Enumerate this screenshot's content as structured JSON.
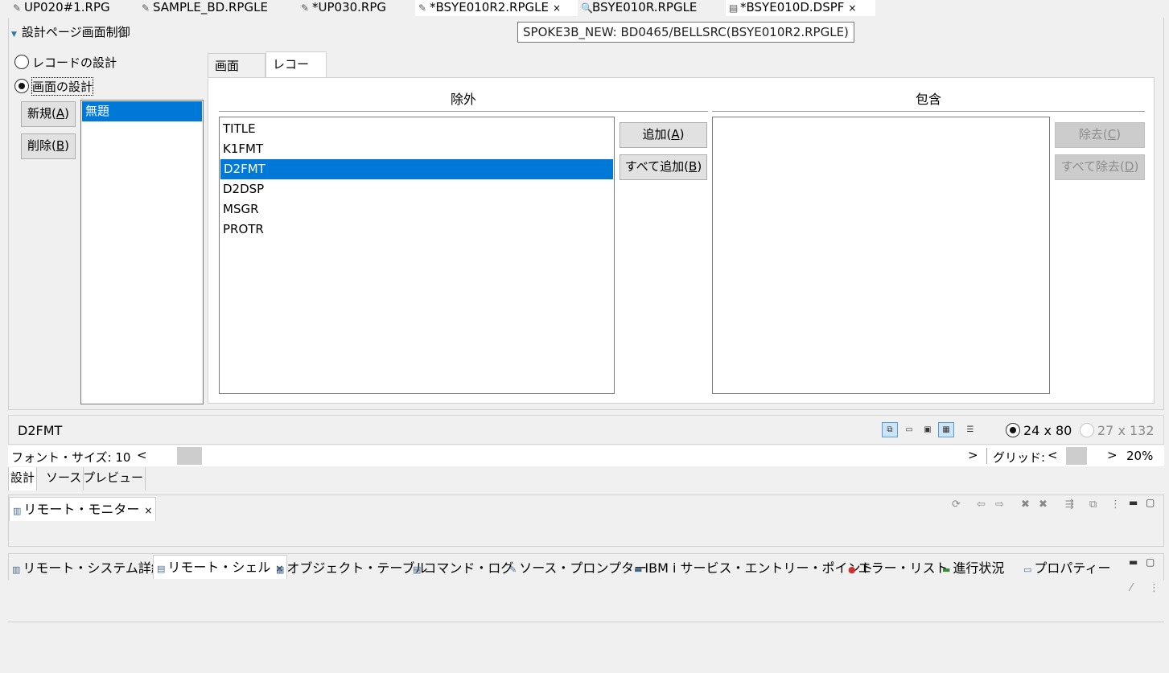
{
  "editor_tabs": [
    {
      "label": "UP020#1.RPG",
      "icon": "pencil-icon"
    },
    {
      "label": "SAMPLE_BD.RPGLE",
      "icon": "pencil-icon"
    },
    {
      "label": "*UP030.RPG",
      "icon": "pencil-icon"
    },
    {
      "label": "*BSYE010R2.RPGLE",
      "icon": "pencil-icon",
      "close": "×"
    },
    {
      "label": "BSYE010R.RPGLE",
      "icon": "search-icon"
    },
    {
      "label": "*BSYE010D.DSPF",
      "icon": "dspf-icon",
      "close": "×"
    }
  ],
  "tooltip": "SPOKE3B_NEW: BD0465/BELLSRC(BSYE010R2.RPGLE)",
  "section": {
    "title": "設計ページ画面制御"
  },
  "design_mode": {
    "options": [
      "レコードの設計",
      "画面の設計"
    ],
    "selected": "画面の設計"
  },
  "screen_buttons": {
    "new_label": "新規(",
    "new_key": "A",
    "delete_label": "削除(",
    "delete_key": "B",
    "close_paren": ")"
  },
  "screen_list": [
    "無題"
  ],
  "panel_tabs": [
    "画面",
    "レコード"
  ],
  "exclude": {
    "title": "除外",
    "items": [
      "TITLE",
      "K1FMT",
      "D2FMT",
      "D2DSP",
      "MSGR",
      "PROTR"
    ],
    "selected_index": 2
  },
  "include": {
    "title": "包含",
    "items": []
  },
  "move_buttons": {
    "add_label": "追加(",
    "add_key": "A",
    "add_all_label": "すべて追加(",
    "add_all_key": "B",
    "remove_label": "除去(",
    "remove_key": "C",
    "remove_all_label": "すべて除去(",
    "remove_all_key": "D",
    "close_paren": ")"
  },
  "status": {
    "record_name": "D2FMT",
    "size_options": [
      "24 x 80",
      "27 x 132"
    ],
    "size_selected": "24 x 80"
  },
  "font_row": {
    "font_label": "フォント・サイズ: 10",
    "grid_label": "グリッド:",
    "zoom": "20%",
    "left_arrow": "<",
    "right_arrow": ">"
  },
  "bottom_tabs": [
    "設計",
    "ソース",
    "プレビュー"
  ],
  "monitor_view": {
    "tab": "リモート・モニター",
    "close": "×"
  },
  "lower_views": [
    {
      "label": "リモート・システム詳細",
      "icon": "system-details-icon"
    },
    {
      "label": "リモート・シェル",
      "icon": "shell-icon",
      "close": "×"
    },
    {
      "label": "オブジェクト・テーブル",
      "icon": "table-icon"
    },
    {
      "label": "コマンド・ログ",
      "icon": "log-icon"
    },
    {
      "label": "ソース・プロンプター",
      "icon": "prompter-icon"
    },
    {
      "label": "IBM i サービス・エントリー・ポイント",
      "icon": "entry-point-icon"
    },
    {
      "label": "エラー・リスト",
      "icon": "error-icon"
    },
    {
      "label": "進行状況",
      "icon": "progress-icon"
    },
    {
      "label": "プロパティー",
      "icon": "properties-icon"
    }
  ]
}
